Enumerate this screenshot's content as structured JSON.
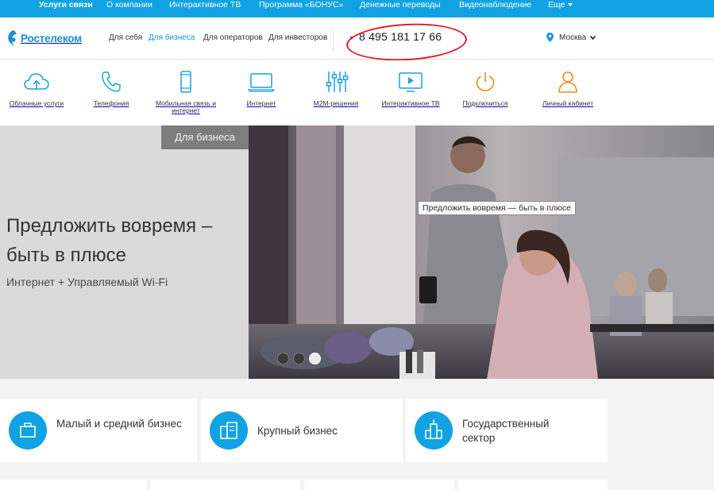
{
  "topbar": {
    "items": [
      "Услуги связи",
      "О компании",
      "Интерактивное ТВ",
      "Программа «БОНУС»",
      "Денежные переводы",
      "Видеонаблюдение",
      "Еще"
    ]
  },
  "header": {
    "logo_text": "Ростелеком",
    "nav": [
      "Для себя",
      "Для бизнеса",
      "Для операторов",
      "Для инвесторов"
    ],
    "phone": "8 495 181 17 66",
    "city": "Москва"
  },
  "services": [
    {
      "label": "Облачные услуги",
      "icon": "cloud-upload-icon"
    },
    {
      "label": "Телефония",
      "icon": "phone-icon"
    },
    {
      "label": "Мобильная связь и интернет",
      "icon": "mobile-phone-icon"
    },
    {
      "label": "Интернет",
      "icon": "laptop-icon"
    },
    {
      "label": "M2M-решения",
      "icon": "sliders-icon"
    },
    {
      "label": "Интерактивное ТВ",
      "icon": "tv-play-icon"
    },
    {
      "label": "Подключиться",
      "icon": "power-icon"
    },
    {
      "label": "Личный кабинет",
      "icon": "user-icon"
    }
  ],
  "hero": {
    "badge": "Для бизнеса",
    "title": "Предложить вовремя – быть в плюсе",
    "subtitle": "Интернет + Управляемый Wi-Fi",
    "tooltip": "Предложить вовремя — быть в плюсе",
    "slides_total": 3,
    "active_slide": 3
  },
  "cards": [
    {
      "label": "Малый и средний бизнес",
      "icon": "briefcase-icon"
    },
    {
      "label": "Крупный бизнес",
      "icon": "buildings-icon"
    },
    {
      "label": "Государственный сектор",
      "icon": "government-building-icon"
    }
  ],
  "colors": {
    "brand": "#10a2e2",
    "annotation": "#e31b23"
  }
}
